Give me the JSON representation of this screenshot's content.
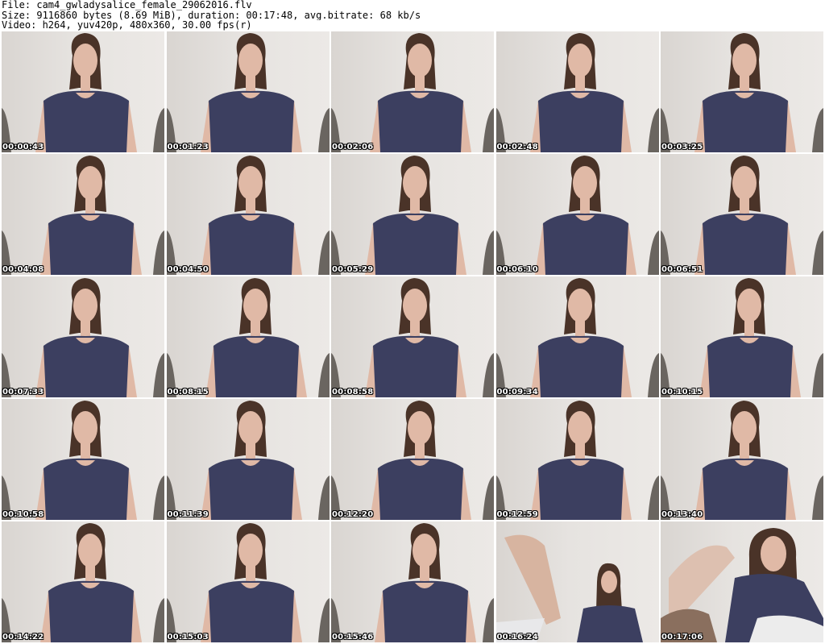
{
  "header": {
    "line1": "File: cam4_gwladysalice_female_29062016.flv",
    "line2": "Size: 9116860 bytes (8.69 MiB), duration: 00:17:48, avg.bitrate: 68 kb/s",
    "line3": "Video: h264, yuv420p, 480x360, 30.00 fps(r)"
  },
  "thumbnails": [
    {
      "time": "00:00:43"
    },
    {
      "time": "00:01:23"
    },
    {
      "time": "00:02:06"
    },
    {
      "time": "00:02:48"
    },
    {
      "time": "00:03:25"
    },
    {
      "time": "00:04:08"
    },
    {
      "time": "00:04:50"
    },
    {
      "time": "00:05:29"
    },
    {
      "time": "00:06:10"
    },
    {
      "time": "00:06:51"
    },
    {
      "time": "00:07:33"
    },
    {
      "time": "00:08:15"
    },
    {
      "time": "00:08:58"
    },
    {
      "time": "00:09:34"
    },
    {
      "time": "00:10:15"
    },
    {
      "time": "00:10:58"
    },
    {
      "time": "00:11:39"
    },
    {
      "time": "00:12:20"
    },
    {
      "time": "00:12:59"
    },
    {
      "time": "00:13:40"
    },
    {
      "time": "00:14:22"
    },
    {
      "time": "00:15:03"
    },
    {
      "time": "00:15:46"
    },
    {
      "time": "00:16:24"
    },
    {
      "time": "00:17:06"
    }
  ],
  "colors": {
    "background": "#ffffff",
    "wall": "#e6e3e0",
    "shirt": "#3c3f60",
    "hair": "#4a3328",
    "skin": "#e0b9a6",
    "timestamp": "#ffffff"
  }
}
